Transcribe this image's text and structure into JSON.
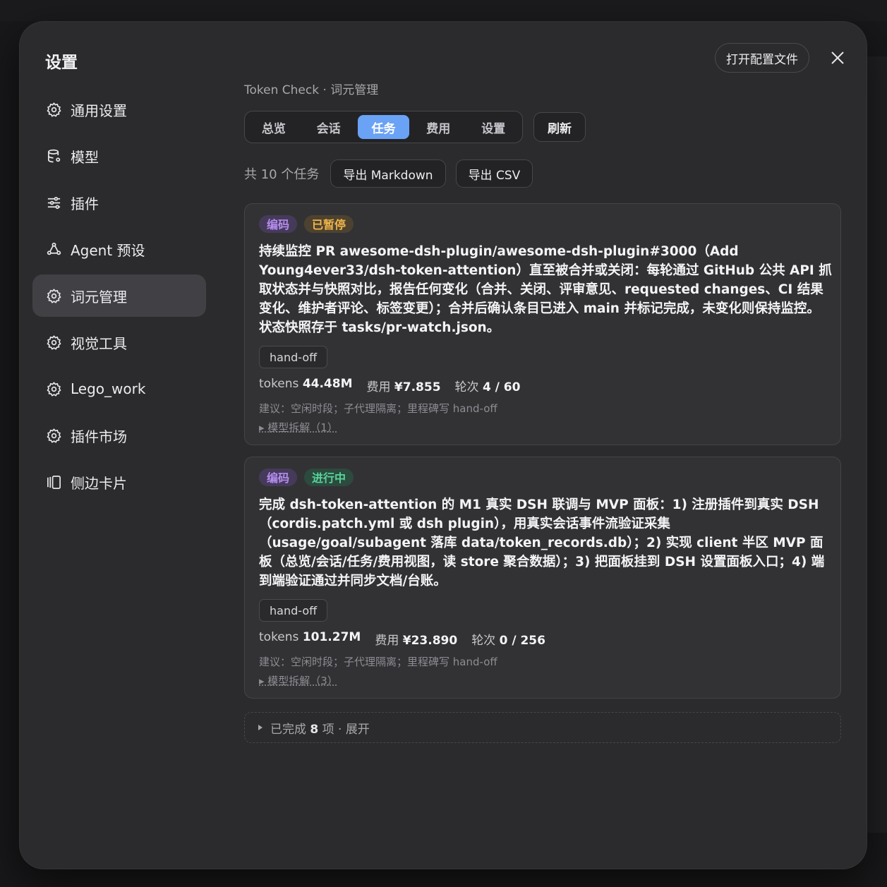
{
  "dialog": {
    "title": "设置",
    "open_config_label": "打开配置文件"
  },
  "nav": [
    {
      "label": "通用设置",
      "icon": "gear-icon"
    },
    {
      "label": "模型",
      "icon": "database-icon"
    },
    {
      "label": "插件",
      "icon": "sliders-icon"
    },
    {
      "label": "Agent 预设",
      "icon": "agent-icon"
    },
    {
      "label": "词元管理",
      "icon": "gear-icon",
      "active": true
    },
    {
      "label": "视觉工具",
      "icon": "gear-icon"
    },
    {
      "label": "Lego_work",
      "icon": "gear-icon"
    },
    {
      "label": "插件市场",
      "icon": "gear-icon"
    },
    {
      "label": "侧边卡片",
      "icon": "cards-icon"
    }
  ],
  "main": {
    "breadcrumb": "Token Check · 词元管理",
    "tabs": [
      "总览",
      "会话",
      "任务",
      "费用",
      "设置"
    ],
    "active_tab": "任务",
    "refresh_label": "刷新",
    "count_text": "共 10 个任务",
    "export_md_label": "导出 Markdown",
    "export_csv_label": "导出 CSV"
  },
  "tasks": [
    {
      "tags": [
        {
          "label": "编码",
          "color": "purple"
        },
        {
          "label": "已暂停",
          "color": "amber"
        }
      ],
      "title": "持续监控 PR awesome-dsh-plugin/awesome-dsh-plugin#3000（Add Young4ever33/dsh-token-attention）直至被合并或关闭：每轮通过 GitHub 公共 API 抓取状态并与快照对比，报告任何变化（合并、关闭、评审意见、requested changes、CI 结果变化、维护者评论、标签变更）；合并后确认条目已进入 main 并标记完成，未变化则保持监控。状态快照存于 tasks/pr-watch.json。",
      "badge": "hand-off",
      "tokens_label": "tokens",
      "tokens": "44.48M",
      "cost_label": "费用",
      "cost": "¥7.855",
      "rounds_label": "轮次",
      "rounds": "4 / 60",
      "advice": "建议：空闲时段；子代理隔离；里程碑写 hand-off",
      "model_toggle": "▸ 模型拆解（1）"
    },
    {
      "tags": [
        {
          "label": "编码",
          "color": "purple"
        },
        {
          "label": "进行中",
          "color": "green"
        }
      ],
      "title": "完成 dsh-token-attention 的 M1 真实 DSH 联调与 MVP 面板：1) 注册插件到真实 DSH（cordis.patch.yml 或 dsh plugin），用真实会话事件流验证采集（usage/goal/subagent 落库 data/token_records.db）；2) 实现 client 半区 MVP 面板（总览/会话/任务/费用视图，读 store 聚合数据）；3) 把面板挂到 DSH 设置面板入口；4) 端到端验证通过并同步文档/台账。",
      "badge": "hand-off",
      "tokens_label": "tokens",
      "tokens": "101.27M",
      "cost_label": "费用",
      "cost": "¥23.890",
      "rounds_label": "轮次",
      "rounds": "0 / 256",
      "advice": "建议：空闲时段；子代理隔离；里程碑写 hand-off",
      "model_toggle": "▸ 模型拆解（3）"
    }
  ],
  "completed": {
    "prefix": "已完成",
    "count": "8",
    "suffix": "项 · 展开"
  },
  "colors": {
    "accent": "#6aa2f5",
    "tag_purple": "#b58df0",
    "tag_amber": "#f0b64a",
    "tag_green": "#58d49a"
  }
}
